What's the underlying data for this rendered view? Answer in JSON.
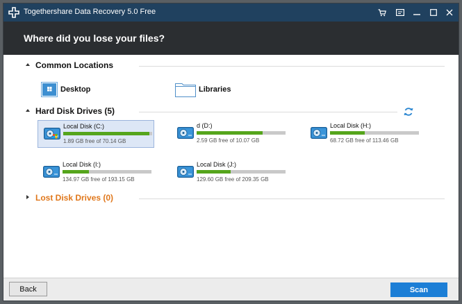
{
  "window": {
    "title": "Togethershare Data Recovery 5.0 Free",
    "titlebar_buttons": [
      "cart-icon",
      "register-icon",
      "minimize-icon",
      "maximize-icon",
      "close-icon"
    ]
  },
  "header": {
    "title": "Where did you lose your files?"
  },
  "sections": {
    "common": {
      "title": "Common Locations"
    },
    "hard": {
      "title": "Hard Disk Drives (5)"
    },
    "lost": {
      "title": "Lost Disk Drives (0)"
    }
  },
  "locations": [
    {
      "label": "Desktop",
      "icon": "desktop-icon"
    },
    {
      "label": "Libraries",
      "icon": "folder-icon"
    }
  ],
  "drives": [
    {
      "name": "Local Disk (C:)",
      "free": "1.89 GB free of 70.14 GB",
      "used_fraction": 0.97,
      "selected": true,
      "system": true
    },
    {
      "name": "d (D:)",
      "free": "2.59 GB free of 10.07 GB",
      "used_fraction": 0.74,
      "selected": false,
      "system": false
    },
    {
      "name": "Local Disk (H:)",
      "free": "68.72 GB free of 113.46 GB",
      "used_fraction": 0.39,
      "selected": false,
      "system": false
    },
    {
      "name": "Local Disk (I:)",
      "free": "134.97 GB free of 193.15 GB",
      "used_fraction": 0.3,
      "selected": false,
      "system": false
    },
    {
      "name": "Local Disk (J:)",
      "free": "129.60 GB free of 209.35 GB",
      "used_fraction": 0.38,
      "selected": false,
      "system": false
    }
  ],
  "footer": {
    "back_label": "Back",
    "scan_label": "Scan"
  },
  "colors": {
    "titlebar": "#20415f",
    "header": "#2b2e31",
    "usage_bar": "#55a51c",
    "lost_section": "#e0771b",
    "scan_button": "#1c7ed6"
  }
}
